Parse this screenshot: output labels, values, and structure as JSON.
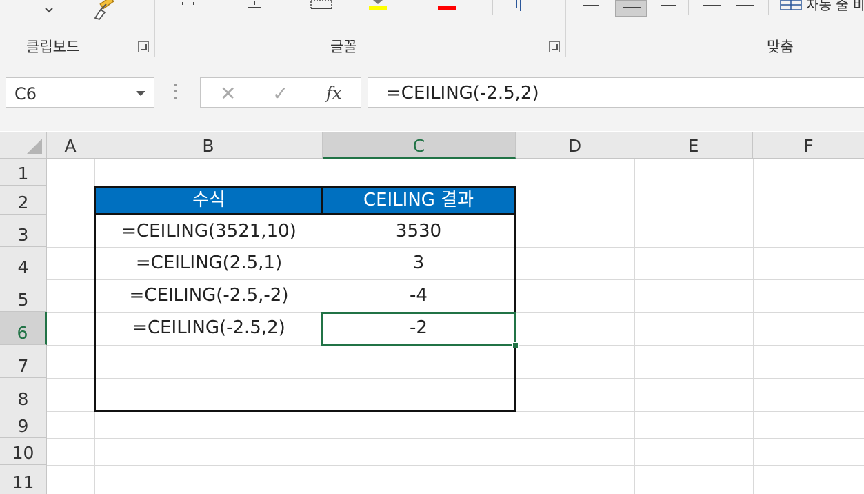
{
  "ribbon": {
    "groups": [
      {
        "label": "클립보드"
      },
      {
        "label": "글꼴"
      },
      {
        "label": "맞춤"
      }
    ],
    "wrap_text_label": "자동 줄 바꿈",
    "font_color": "#ff0000",
    "highlight_color": "#ffff00"
  },
  "formula_bar": {
    "name_box": "C6",
    "cancel_icon": "✕",
    "enter_icon": "✓",
    "fx_label": "fx",
    "formula": "=CEILING(-2.5,2)"
  },
  "columns": [
    "A",
    "B",
    "C",
    "D",
    "E",
    "F"
  ],
  "rows": [
    "1",
    "2",
    "3",
    "4",
    "5",
    "6",
    "7",
    "8",
    "9",
    "10",
    "11"
  ],
  "table": {
    "header_color": "#0070c0",
    "header": [
      "수식",
      "CEILING 결과"
    ],
    "rows": [
      {
        "formula": "=CEILING(3521,10)",
        "result": "3530"
      },
      {
        "formula": "=CEILING(2.5,1)",
        "result": "3"
      },
      {
        "formula": "=CEILING(-2.5,-2)",
        "result": "-4"
      },
      {
        "formula": "=CEILING(-2.5,2)",
        "result": "-2"
      }
    ]
  },
  "selection": {
    "cell": "C6",
    "accent_color": "#217346"
  }
}
